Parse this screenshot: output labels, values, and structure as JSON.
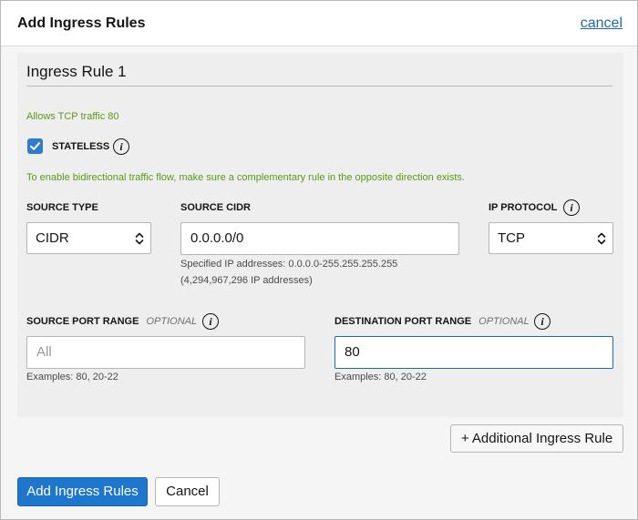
{
  "dialog": {
    "title": "Add Ingress Rules",
    "cancel_link": "cancel"
  },
  "rule": {
    "title": "Ingress Rule 1",
    "description": "Allows TCP traffic 80",
    "stateless": {
      "checked": true,
      "label": "STATELESS"
    },
    "bidirectional_hint": "To enable bidirectional traffic flow, make sure a complementary rule in the opposite direction exists.",
    "source_type": {
      "label": "SOURCE TYPE",
      "value": "CIDR"
    },
    "source_cidr": {
      "label": "SOURCE CIDR",
      "value": "0.0.0.0/0",
      "help_line1": "Specified IP addresses: 0.0.0.0-255.255.255.255",
      "help_line2": "(4,294,967,296 IP addresses)"
    },
    "ip_protocol": {
      "label": "IP PROTOCOL",
      "value": "TCP"
    },
    "source_port_range": {
      "label": "SOURCE PORT RANGE",
      "optional": "OPTIONAL",
      "value": "",
      "placeholder": "All",
      "help": "Examples: 80, 20-22"
    },
    "destination_port_range": {
      "label": "DESTINATION PORT RANGE",
      "optional": "OPTIONAL",
      "value": "80",
      "placeholder": "",
      "help": "Examples: 80, 20-22"
    }
  },
  "buttons": {
    "additional_rule": "+ Additional Ingress Rule",
    "submit": "Add Ingress Rules",
    "cancel": "Cancel"
  },
  "icons": {
    "info": "info-icon",
    "check": "check-icon",
    "select_chevrons": "chevron-up-down-icon"
  },
  "colors": {
    "primary": "#1f76cd",
    "link": "#1d6aa8",
    "hint_green": "#5a9a18",
    "checkbox": "#2f7bcc"
  }
}
